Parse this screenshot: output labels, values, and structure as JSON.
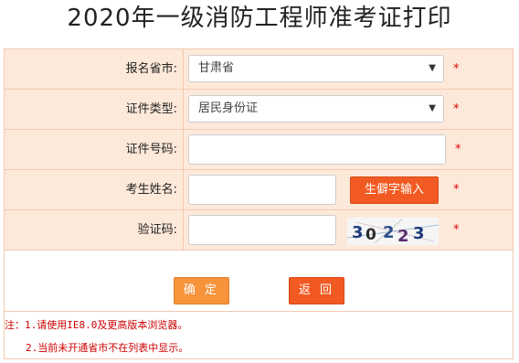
{
  "page_title": "2020年一级消防工程师准考证打印",
  "form": {
    "province": {
      "label": "报名省市:",
      "value": "甘肃省"
    },
    "id_type": {
      "label": "证件类型:",
      "value": "居民身份证"
    },
    "id_number": {
      "label": "证件号码:",
      "value": ""
    },
    "name": {
      "label": "考生姓名:",
      "value": "",
      "rare_char_button": "生僻字输入"
    },
    "captcha": {
      "label": "验证码:",
      "value": "",
      "image_text": "30223"
    },
    "required_mark": "*"
  },
  "buttons": {
    "confirm": "确 定",
    "back": "返 回"
  },
  "notes": [
    "注：1.请使用IE8.0及更高版本浏览器。",
    "2.当前未开通省市不在列表中显示。"
  ],
  "colors": {
    "row_bg": "#fde9da",
    "border": "#f2c9b0",
    "accent": "#f15a22",
    "confirm": "#f7933b",
    "required": "#dd0000"
  },
  "icons": {
    "select_arrow": "chevron-down-icon"
  }
}
